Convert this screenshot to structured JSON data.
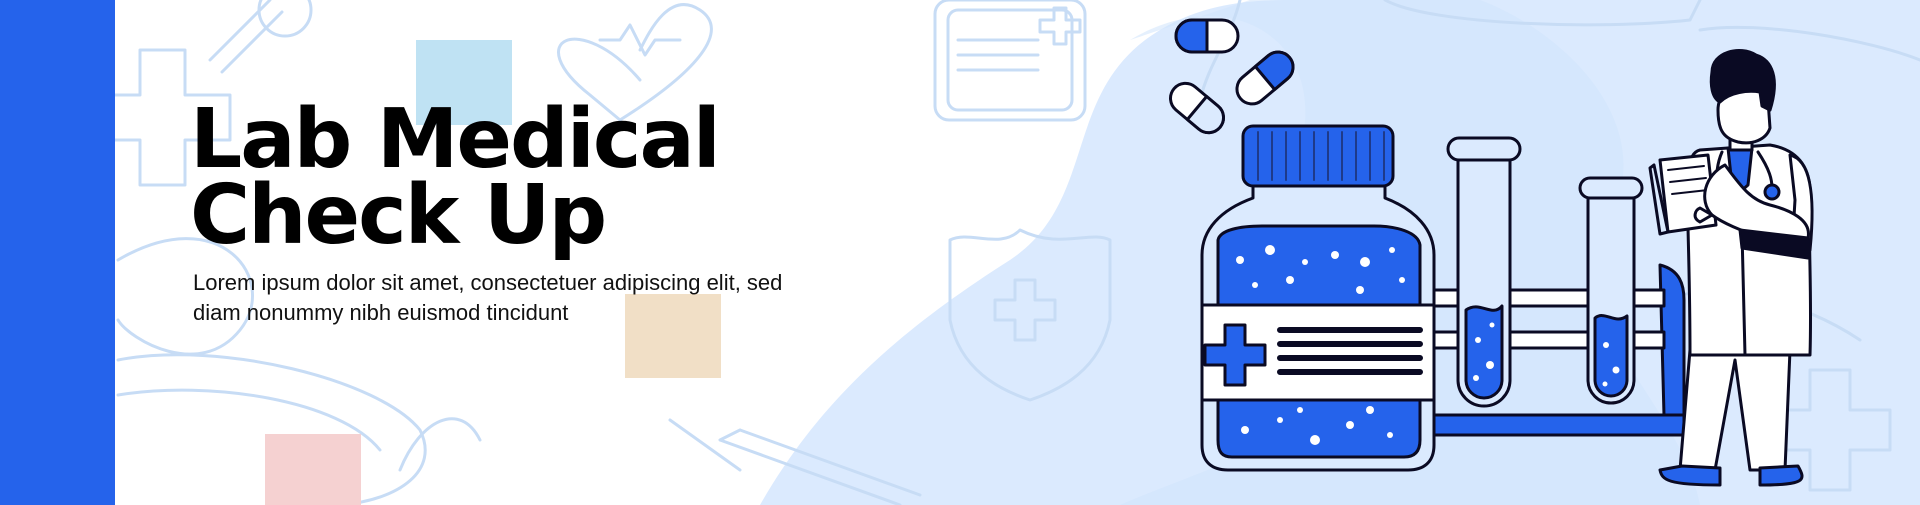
{
  "banner": {
    "headline_line1": "Lab Medical",
    "headline_line2": "Check Up",
    "subtitle": "Lorem ipsum dolor sit amet, consectetuer adipiscing elit, sed diam nonummy nibh euismod tincidunt"
  },
  "colors": {
    "accent_blue": "#2563eb",
    "light_blue": "#dbeafe",
    "line_art": "#c7dcf5",
    "square_blue": "#bfe2f3",
    "square_tan": "#f1dfc6",
    "square_pink": "#f5d1d1"
  },
  "illustration": {
    "icons": [
      "pill-icon",
      "medicine-bottle-icon",
      "test-tube-icon",
      "doctor-icon",
      "clipboard-icon",
      "stethoscope-icon",
      "shield-cross-icon",
      "first-aid-kit-icon",
      "syringe-icon",
      "heart-icon",
      "medical-cross-icon"
    ]
  }
}
